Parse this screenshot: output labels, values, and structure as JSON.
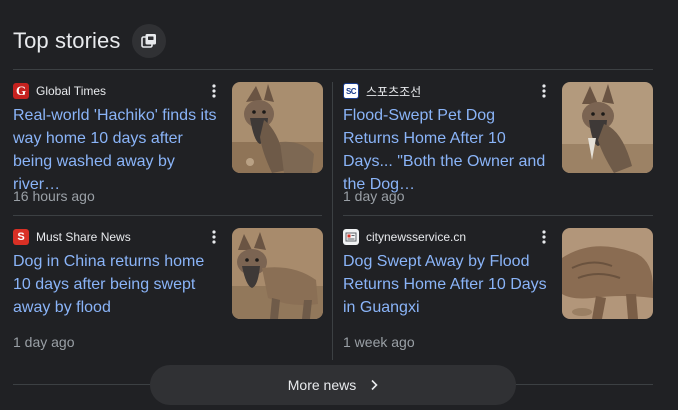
{
  "header": {
    "title": "Top stories"
  },
  "stories": [
    {
      "source": "Global Times",
      "title": "Real-world 'Hachiko' finds its way home 10 days after being washed away by river…",
      "time": "16 hours ago"
    },
    {
      "source": "스포츠조선",
      "title": "Flood-Swept Pet Dog Returns Home After 10 Days... \"Both the Owner and the Dog…",
      "time": "1 day ago"
    },
    {
      "source": "Must Share News",
      "title": "Dog in China returns home 10 days after being swept away by flood",
      "time": "1 day ago"
    },
    {
      "source": "citynewsservice.cn",
      "title": "Dog Swept Away by Flood Returns Home After 10 Days in Guangxi",
      "time": "1 week ago"
    }
  ],
  "footer": {
    "more_label": "More news"
  },
  "colors": {
    "background": "#202124",
    "link": "#8ab4f8",
    "text": "#e8eaed",
    "muted": "#9aa0a6",
    "divider": "#3c4043",
    "button_bg": "#303134"
  },
  "icons": {
    "header_button": "stack-icon",
    "menu": "more-vert-icon",
    "more": "chevron-right-icon"
  }
}
